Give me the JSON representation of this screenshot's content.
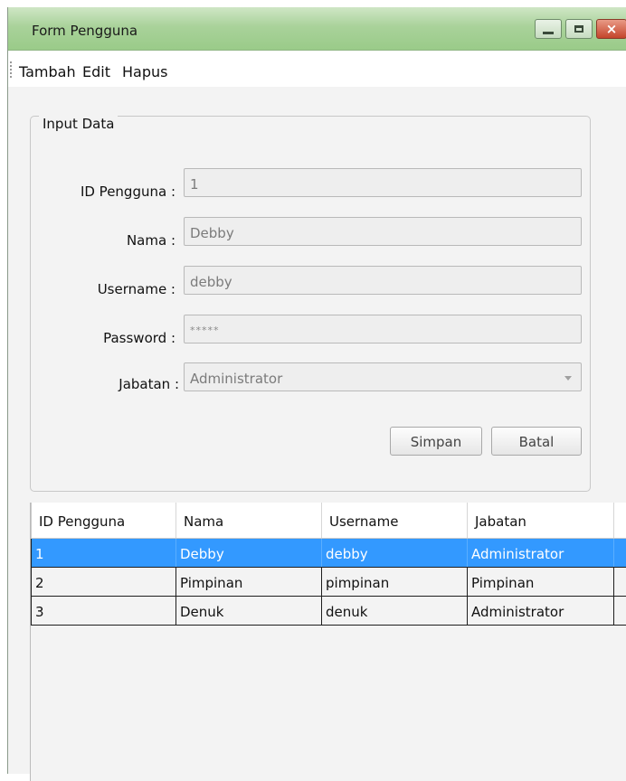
{
  "window": {
    "title": "Form Pengguna",
    "controls": [
      "minimize",
      "maximize",
      "close"
    ],
    "close_glyph": "×"
  },
  "menu": {
    "items": [
      "Tambah",
      "Edit",
      "Hapus"
    ]
  },
  "form": {
    "group_title": "Input Data",
    "fields": {
      "id": {
        "label": "ID Pengguna :",
        "value": "1"
      },
      "nama": {
        "label": "Nama :",
        "value": "Debby"
      },
      "username": {
        "label": "Username :",
        "value": "debby"
      },
      "password": {
        "label": "Password :",
        "value": "*****"
      },
      "jabatan": {
        "label": "Jabatan :",
        "value": "Administrator"
      }
    },
    "buttons": {
      "save": "Simpan",
      "cancel": "Batal"
    }
  },
  "table": {
    "columns": [
      "ID Pengguna",
      "Nama",
      "Username",
      "Jabatan"
    ],
    "rows": [
      [
        "1",
        "Debby",
        "debby",
        "Administrator"
      ],
      [
        "2",
        "Pimpinan",
        "pimpinan",
        "Pimpinan"
      ],
      [
        "3",
        "Denuk",
        "denuk",
        "Administrator"
      ]
    ],
    "selected_row": 0
  },
  "colors": {
    "titlebar": "#a9d29a",
    "selection": "#3399ff",
    "close_button": "#c4452b"
  }
}
